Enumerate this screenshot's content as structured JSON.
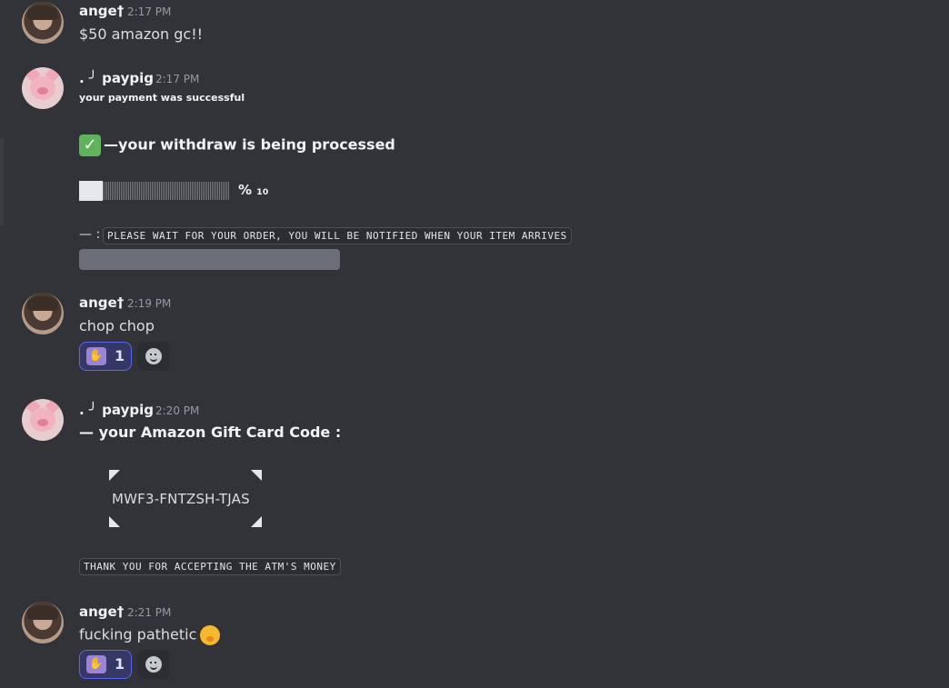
{
  "messages": [
    {
      "author": "ange†",
      "time": "2:17 PM",
      "text": "$50 amazon gc!!"
    },
    {
      "author": ". ╯ paypig",
      "time": "2:17 PM",
      "line1": "your payment was successful",
      "line2": "—your withdraw is being processed",
      "percent": "% ₁₀",
      "progress_fraction": 0.1,
      "prefix": "— :",
      "notice": "PLEASE WAIT FOR YOUR ORDER, YOU WILL BE NOTIFIED WHEN YOUR ITEM ARRIVES"
    },
    {
      "author": "ange†",
      "time": "2:19 PM",
      "text": "chop chop",
      "reaction_count": "1"
    },
    {
      "author": ". ╯ paypig",
      "time": "2:20 PM",
      "header": "—  your Amazon Gift Card Code :",
      "code": "MWF3-FNTZSH-TJAS",
      "footer": "THANK YOU FOR ACCEPTING THE ATM'S MONEY"
    },
    {
      "author": "ange†",
      "time": "2:21 PM",
      "text": "fucking pathetic",
      "reaction_count": "1"
    }
  ],
  "icons": {
    "check": "white-check-mark-icon",
    "reaction": "praying-figure-emoji-icon",
    "add_reaction": "add-reaction-icon",
    "face": "hand-over-mouth-emoji-icon"
  },
  "colors": {
    "background": "#313338",
    "reaction_border": "#5865f2",
    "check": "#5fb35a"
  }
}
